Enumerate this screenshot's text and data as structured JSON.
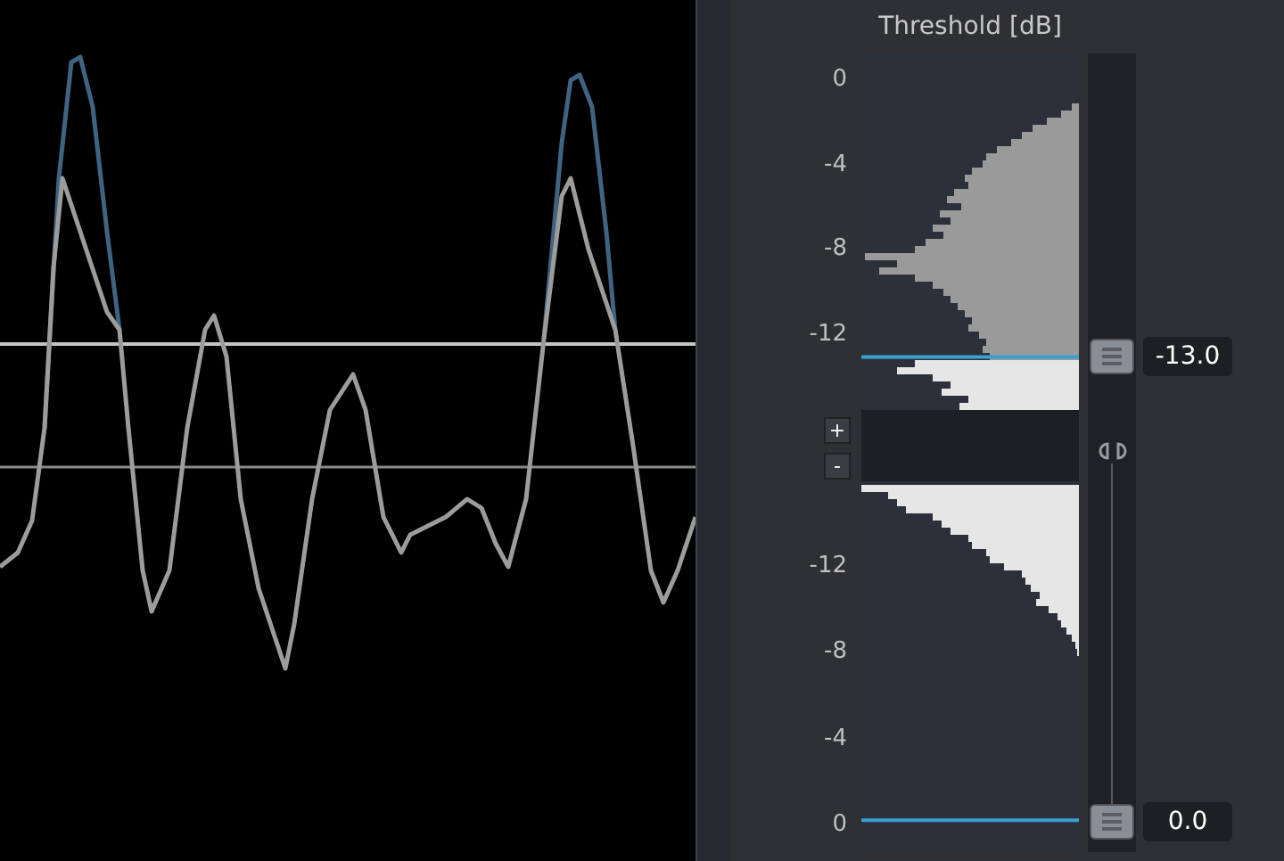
{
  "title": "Threshold [dB]",
  "upper_scale": [
    "0",
    "-4",
    "-8",
    "-12"
  ],
  "lower_scale": [
    "-12",
    "-8",
    "-4",
    "0"
  ],
  "zoom_buttons": [
    {
      "label": "+"
    },
    {
      "label": "-"
    }
  ],
  "sliders": [
    {
      "value": "-13.0"
    },
    {
      "value": "0.0"
    }
  ]
}
